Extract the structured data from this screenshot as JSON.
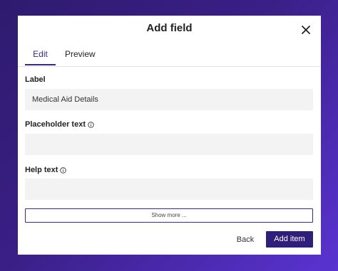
{
  "modal": {
    "title": "Add field"
  },
  "tabs": [
    {
      "label": "Edit",
      "active": true
    },
    {
      "label": "Preview",
      "active": false
    }
  ],
  "fields": {
    "label": {
      "label": "Label",
      "value": "Medical Aid Details"
    },
    "placeholder": {
      "label": "Placeholder text",
      "value": ""
    },
    "help": {
      "label": "Help text",
      "value": ""
    }
  },
  "show_more_label": "Show more ...",
  "footer": {
    "back_label": "Back",
    "add_label": "Add item"
  },
  "colors": {
    "accent": "#3a2a8a",
    "primary_button": "#2f1f7a",
    "input_background": "#f3f3f3"
  },
  "icons": {
    "close": "close-icon",
    "info": "info-icon"
  }
}
